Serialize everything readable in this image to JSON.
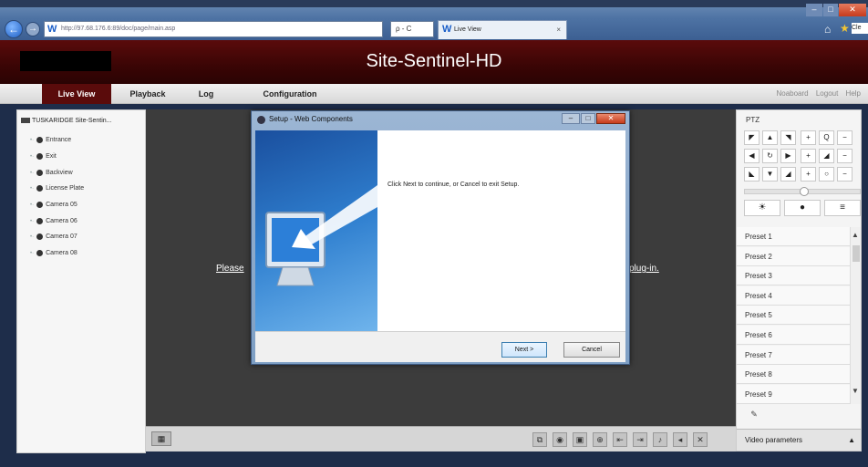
{
  "browser": {
    "address_url": "http://97.68.176.6:89/doc/page/main.asp",
    "addr_controls": "ρ - C",
    "tab_title": "Live View",
    "tab_close": "×",
    "clear_chip": "Cle",
    "back_glyph": "←",
    "fwd_glyph": "→",
    "favicon": "W",
    "home_glyph": "⌂",
    "star_glyph": "★",
    "min_glyph": "–",
    "max_glyph": "□",
    "close_glyph": "✕"
  },
  "app": {
    "title": "Site-Sentinel-HD",
    "nav": {
      "live": "Live View",
      "playback": "Playback",
      "log": "Log",
      "config": "Configuration"
    },
    "nav_right": [
      "Noaboard",
      "Logout",
      "Help"
    ]
  },
  "tree": {
    "root": "TUSKARIDGE Site-Sentin...",
    "items": [
      "Entrance",
      "Exit",
      "Backview",
      "License Plate",
      "Camera 05",
      "Camera 06",
      "Camera 07",
      "Camera 08"
    ]
  },
  "video": {
    "plugin_left": "Please",
    "plugin_right": "plug-in."
  },
  "ptz": {
    "label": "PTZ",
    "presets": [
      "Preset 1",
      "Preset 2",
      "Preset 3",
      "Preset 4",
      "Preset 5",
      "Preset 6",
      "Preset 7",
      "Preset 8",
      "Preset 9"
    ],
    "video_params": "Video parameters"
  },
  "dialog": {
    "title": "Setup - Web Components",
    "message": "Click Next to continue, or Cancel to exit Setup.",
    "next": "Next >",
    "cancel": "Cancel"
  }
}
